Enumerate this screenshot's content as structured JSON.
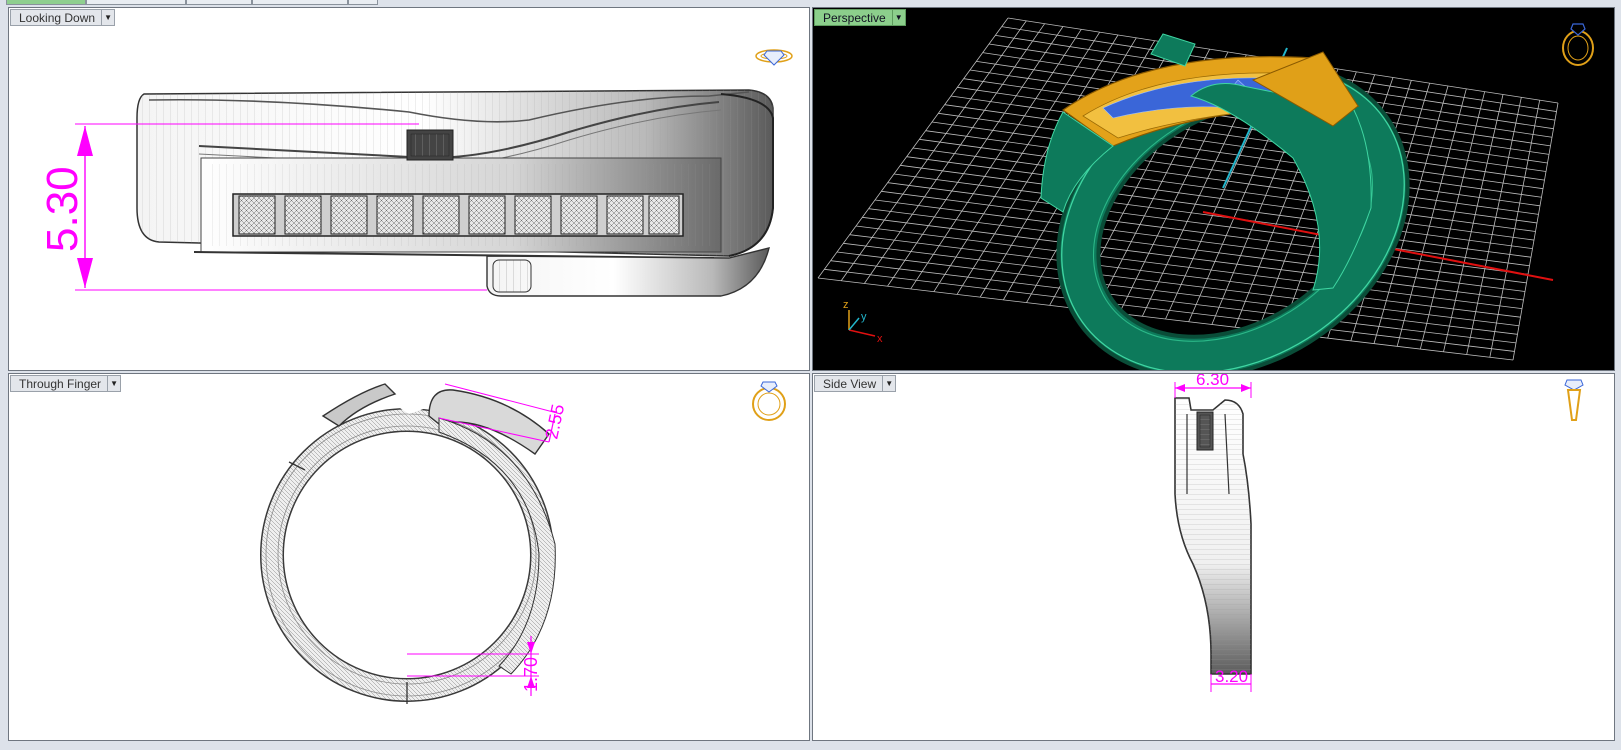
{
  "tabs": [
    "",
    "",
    "",
    "",
    ""
  ],
  "viewports": {
    "top_left": {
      "title": "Looking Down",
      "dimension": "5.30"
    },
    "top_right": {
      "title": "Perspective",
      "axes": {
        "z": "z",
        "y": "y",
        "x": "x"
      }
    },
    "bottom_left": {
      "title": "Through Finger",
      "dimension_top": "2.55",
      "dimension_bottom": "1.70"
    },
    "bottom_right": {
      "title": "Side View",
      "dimension_top": "6.30",
      "dimension_bottom": "3.20"
    }
  },
  "icons": {
    "top_left": "ring-gem-icon",
    "top_right": "ring-icon",
    "bottom_left": "ring-icon",
    "bottom_right": "ring-side-icon"
  },
  "colors": {
    "dimension": "#ff00ff",
    "active_view": "#8ccf8c",
    "metal_green": "#0e7a5a",
    "metal_gold": "#e0a018",
    "stones": "#3a66d8",
    "grid": "#bfbfbf",
    "axis_x": "#d01010",
    "axis_y": "#20b0c8"
  }
}
